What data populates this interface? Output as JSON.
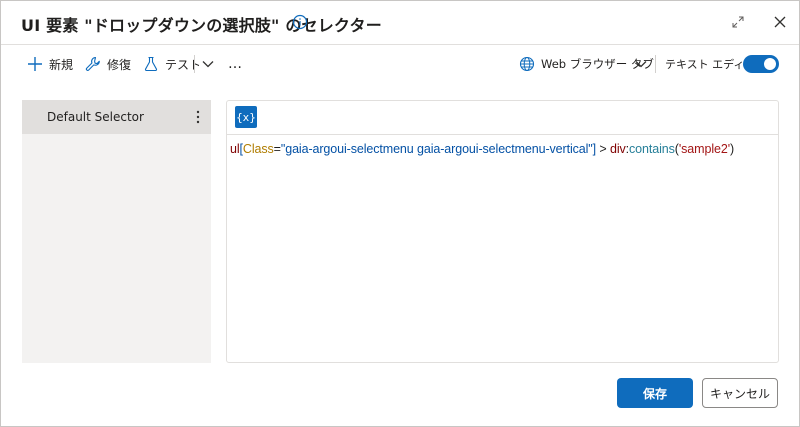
{
  "dialog": {
    "title": "UI 要素 \"ドロップダウンの選択肢\" のセレクター"
  },
  "toolbar": {
    "new_label": "新規",
    "repair_label": "修復",
    "test_label": "テスト",
    "more_label": "…",
    "browser_tab_label": "Web ブラウザー タブ",
    "text_editor_label": "テキスト エディター",
    "text_editor_enabled": true
  },
  "selectors": {
    "items": [
      {
        "label": "Default Selector"
      }
    ]
  },
  "editor": {
    "var_button_label": "{x}",
    "code": {
      "tag": "ul",
      "open_bracket": "[",
      "attr": "Class",
      "eq": "=",
      "value": "\"gaia-argoui-selectmenu gaia-argoui-selectmenu-vertical\"",
      "close_bracket": "]",
      "combinator": " > ",
      "child_tag": "div",
      "colon": ":",
      "pseudo": "contains",
      "paren_open": "(",
      "arg": "'sample2'",
      "paren_close": ")"
    }
  },
  "footer": {
    "save_label": "保存",
    "cancel_label": "キャンセル"
  },
  "colors": {
    "accent": "#0f6cbd",
    "panel_bg": "#f3f2f1",
    "selected_item_bg": "#e1dfdd"
  }
}
